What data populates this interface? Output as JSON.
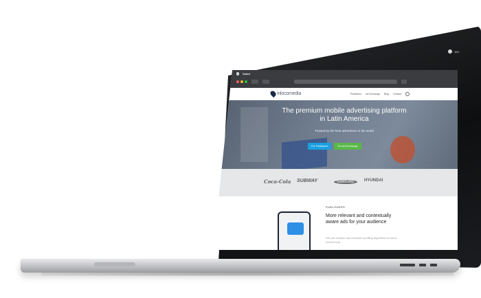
{
  "browser": {
    "app_name": "Safari",
    "status_text": "10C"
  },
  "site": {
    "logo_text": "inlocomedia",
    "nav": [
      "Publishers",
      "Ad Exchange",
      "Blog",
      "Contact"
    ]
  },
  "hero": {
    "title": "The premium mobile advertising platform in Latin America",
    "subtitle": "Trusted by the best advertisers in the world",
    "btn_publishers": "For Publishers",
    "btn_exchange": "For Ad Exchange"
  },
  "brands": [
    "Coca-Cola",
    "SUBWAY",
    "SAMSUNG",
    "HYUNDAI"
  ],
  "publishers": {
    "label": "PUBLISHERS",
    "title": "More relevant and contextually aware ads for your audience",
    "body": "We use location and exclusive profiling algorithms to serve content that"
  },
  "colors": {
    "accent_blue": "#1aa0e0",
    "accent_green": "#58b947",
    "lid": "#111214",
    "base": "#c7c8cb"
  }
}
